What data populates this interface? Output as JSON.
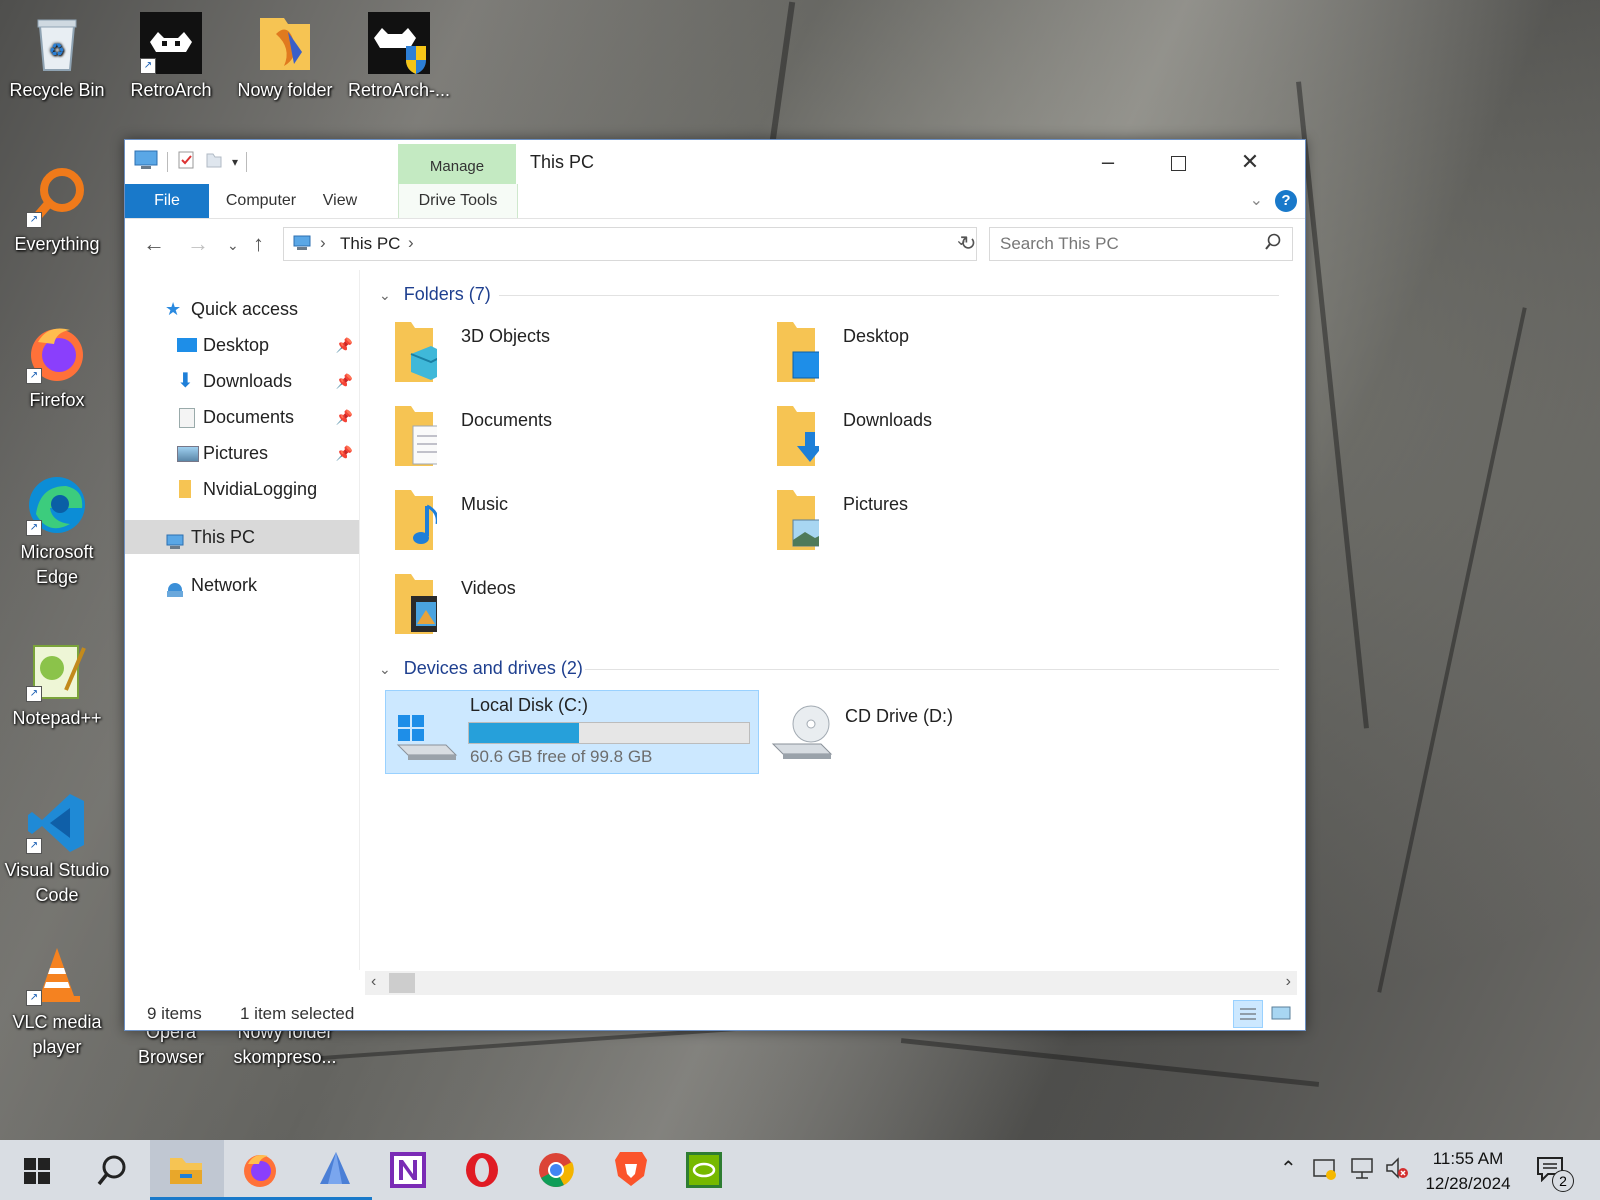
{
  "desktop": {
    "icons": [
      {
        "label": "Recycle Bin"
      },
      {
        "label": "RetroArch"
      },
      {
        "label": "Nowy folder"
      },
      {
        "label": "RetroArch-..."
      },
      {
        "label": "Everything"
      },
      {
        "label": "Firefox"
      },
      {
        "label": "Microsoft Edge"
      },
      {
        "label": "Notepad++"
      },
      {
        "label": "Visual Studio Code"
      },
      {
        "label": "VLC media player"
      },
      {
        "label": "Opera Browser"
      },
      {
        "label": "Nowy folder skompreso..."
      }
    ]
  },
  "window": {
    "title": "This PC",
    "contextual_tab": "Manage",
    "ribbon_tabs": [
      "File",
      "Computer",
      "View",
      "Drive Tools"
    ],
    "help": "?",
    "address": {
      "location": "This PC"
    },
    "search": {
      "placeholder": "Search This PC"
    }
  },
  "nav_pane": {
    "quick_access": "Quick access",
    "items": [
      {
        "label": "Desktop"
      },
      {
        "label": "Downloads"
      },
      {
        "label": "Documents"
      },
      {
        "label": "Pictures"
      },
      {
        "label": "NvidiaLogging"
      }
    ],
    "this_pc": "This PC",
    "network": "Network"
  },
  "content": {
    "folders_header": "Folders (7)",
    "folders": [
      {
        "label": "3D Objects"
      },
      {
        "label": "Desktop"
      },
      {
        "label": "Documents"
      },
      {
        "label": "Downloads"
      },
      {
        "label": "Music"
      },
      {
        "label": "Pictures"
      },
      {
        "label": "Videos"
      }
    ],
    "devices_header": "Devices and drives (2)",
    "drives": [
      {
        "label": "Local Disk (C:)",
        "detail": "60.6 GB free of 99.8 GB",
        "used_fraction": 0.393
      },
      {
        "label": "CD Drive (D:)"
      }
    ]
  },
  "status": {
    "items": "9 items",
    "selected": "1 item selected"
  },
  "taskbar": {
    "clock": {
      "time": "11:55 AM",
      "date": "12/28/2024"
    },
    "notifications": "2"
  },
  "colors": {
    "accent": "#1979ca",
    "selection": "#cce8ff",
    "manage_tab": "#c4eac2",
    "drive_bar": "#26a0da"
  }
}
